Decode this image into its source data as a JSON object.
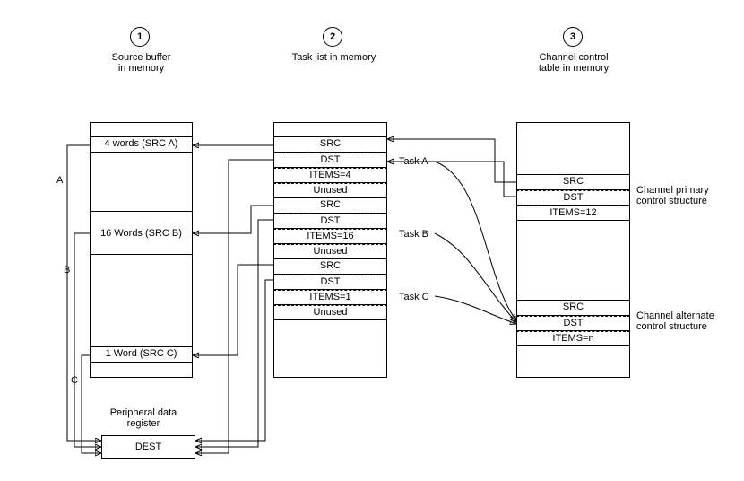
{
  "columns": {
    "col1": {
      "number": "1",
      "title_l1": "Source buffer",
      "title_l2": "in memory"
    },
    "col2": {
      "number": "2",
      "title_l1": "Task list in memory"
    },
    "col3": {
      "number": "3",
      "title_l1": "Channel control",
      "title_l2": "table in memory"
    }
  },
  "source": {
    "srcA": "4 words (SRC A)",
    "srcB": "16 Words (SRC B)",
    "srcC": "1 Word (SRC C)",
    "gapA": "A",
    "gapB": "B",
    "gapC": "C"
  },
  "peripheral": {
    "label_l1": "Peripheral data",
    "label_l2": "register",
    "dest": "DEST"
  },
  "tasklist": {
    "taskA": {
      "src": "SRC",
      "dst": "DST",
      "items": "ITEMS=4",
      "unused": "Unused"
    },
    "taskB": {
      "src": "SRC",
      "dst": "DST",
      "items": "ITEMS=16",
      "unused": "Unused"
    },
    "taskC": {
      "src": "SRC",
      "dst": "DST",
      "items": "ITEMS=1",
      "unused": "Unused"
    },
    "labelA": "Task A",
    "labelB": "Task B",
    "labelC": "Task C"
  },
  "channel": {
    "primary": {
      "src": "SRC",
      "dst": "DST",
      "items": "ITEMS=12",
      "label_l1": "Channel primary",
      "label_l2": "control structure"
    },
    "alternate": {
      "src": "SRC",
      "dst": "DST",
      "items": "ITEMS=n",
      "label_l1": "Channel alternate",
      "label_l2": "control structure"
    }
  }
}
